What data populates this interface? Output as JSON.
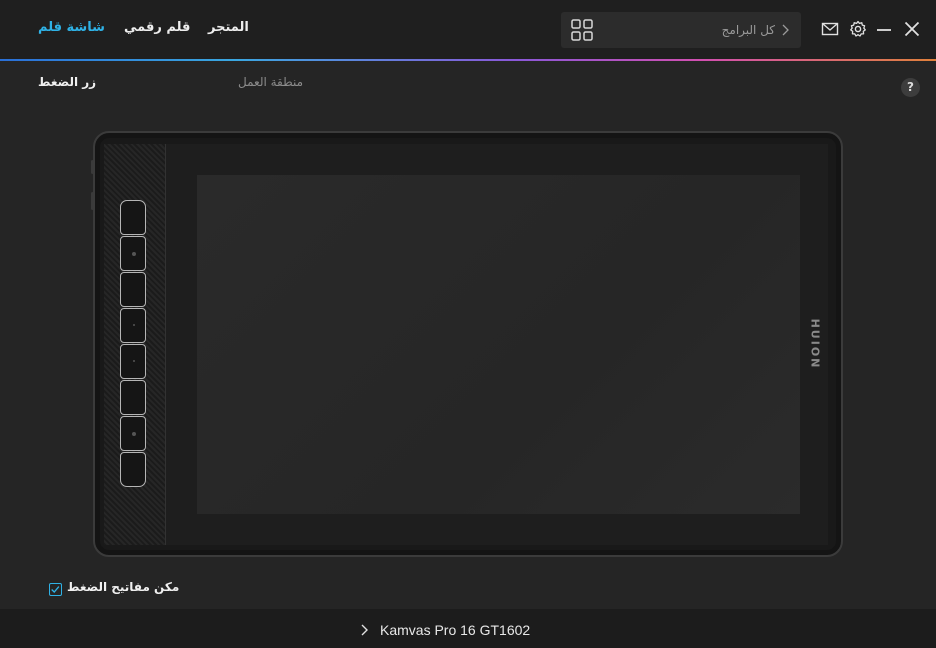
{
  "nav": {
    "tabs": [
      {
        "label": "شاشة قلم",
        "active": true
      },
      {
        "label": "قلم رقمي",
        "active": false
      },
      {
        "label": "المتجر",
        "active": false
      }
    ]
  },
  "search": {
    "placeholder": "كل البرامج"
  },
  "sub_tabs": {
    "press_keys": "زر الضغط",
    "work_area": "منطقة العمل"
  },
  "help": {
    "label": "?"
  },
  "tablet": {
    "brand": "HUION",
    "press_key_count": 8
  },
  "enable_keys": {
    "label": "مكن مفاتيح الضغط",
    "checked": true
  },
  "device": {
    "name": "Kamvas Pro 16 GT1602"
  },
  "colors": {
    "accent": "#2fb2e6",
    "background": "#252525",
    "topbar": "#1f1f1f"
  },
  "icons": {
    "apps_grid": "grid-icon",
    "search_chevron": "chevron-right-icon",
    "mail": "mail-icon",
    "settings": "gear-icon",
    "minimize": "minimize-icon",
    "close": "close-icon",
    "device_chevron": "chevron-right-icon"
  }
}
